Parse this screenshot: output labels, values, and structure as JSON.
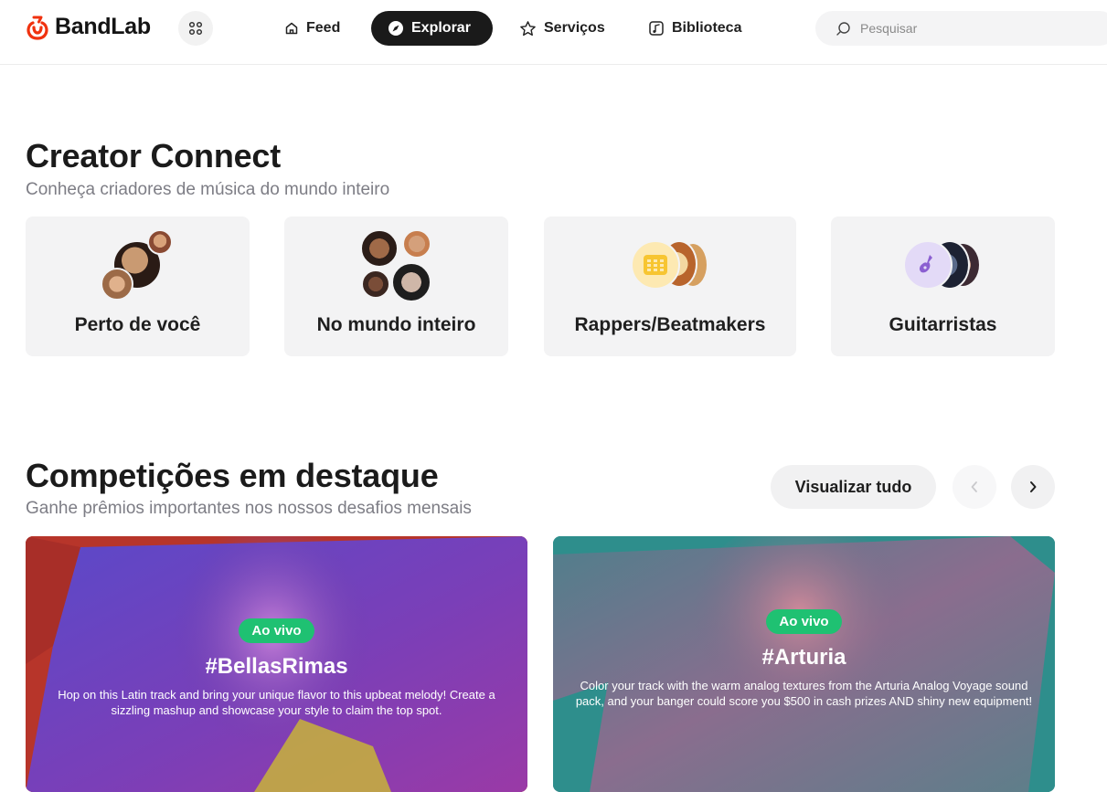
{
  "header": {
    "brand": "BandLab",
    "nav": {
      "feed": "Feed",
      "explore": "Explorar",
      "services": "Serviços",
      "library": "Biblioteca"
    },
    "search_placeholder": "Pesquisar"
  },
  "creator_connect": {
    "title": "Creator Connect",
    "subtitle": "Conheça criadores de música do mundo inteiro",
    "cards": [
      {
        "label": "Perto de você"
      },
      {
        "label": "No mundo inteiro"
      },
      {
        "label": "Rappers/Beatmakers"
      },
      {
        "label": "Guitarristas"
      }
    ]
  },
  "competitions": {
    "title": "Competições em destaque",
    "subtitle": "Ganhe prêmios importantes nos nossos desafios mensais",
    "view_all": "Visualizar tudo",
    "items": [
      {
        "badge": "Ao vivo",
        "tag": "#BellasRimas",
        "description": "Hop on this Latin track and bring your unique flavor to this upbeat melody! Create a sizzling mashup and showcase your style to claim the top spot."
      },
      {
        "badge": "Ao vivo",
        "tag": "#Arturia",
        "description": "Color your track with the warm analog textures from the Arturia Analog Voyage sound pack, and your banger could score you $500 in cash prizes AND shiny new equipment!"
      }
    ]
  },
  "colors": {
    "brand": "#f0320f",
    "live_badge": "#1fc172",
    "nav_active": "#1a1a1a"
  },
  "icons": {
    "apps": "apps-grid-icon",
    "feed": "home-icon",
    "explore": "compass-icon",
    "services": "star-icon",
    "library": "music-note-icon",
    "search": "search-icon",
    "prev": "chevron-left-icon",
    "next": "chevron-right-icon"
  }
}
